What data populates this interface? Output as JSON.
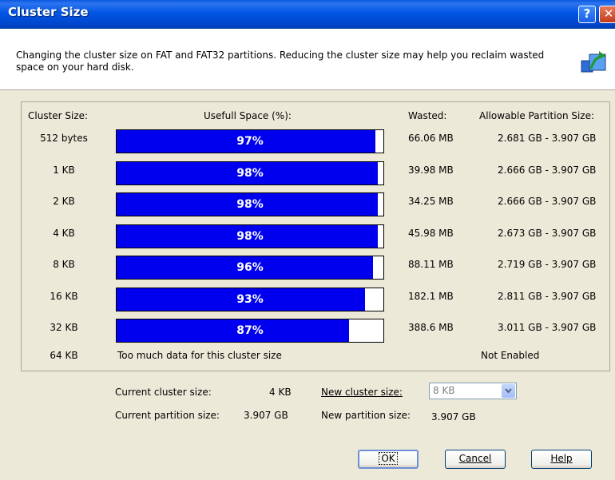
{
  "window": {
    "title": "Cluster Size"
  },
  "header": {
    "description": "Changing the cluster size on FAT and FAT32 partitions. Reducing the cluster size may help you reclaim wasted space on your hard disk."
  },
  "table": {
    "columns": {
      "cluster_size": "Cluster Size:",
      "useful_space": "Usefull Space (%):",
      "wasted": "Wasted:",
      "allowable": "Allowable Partition Size:"
    },
    "rows": [
      {
        "cluster": "512 bytes",
        "percent_label": "97%",
        "percent": 97,
        "wasted": "66.06 MB",
        "allowable": "2.681 GB - 3.907 GB"
      },
      {
        "cluster": "1 KB",
        "percent_label": "98%",
        "percent": 98,
        "wasted": "39.98 MB",
        "allowable": "2.666 GB - 3.907 GB"
      },
      {
        "cluster": "2 KB",
        "percent_label": "98%",
        "percent": 98,
        "wasted": "34.25 MB",
        "allowable": "2.666 GB - 3.907 GB"
      },
      {
        "cluster": "4 KB",
        "percent_label": "98%",
        "percent": 98,
        "wasted": "45.98 MB",
        "allowable": "2.673 GB - 3.907 GB"
      },
      {
        "cluster": "8 KB",
        "percent_label": "96%",
        "percent": 96,
        "wasted": "88.11 MB",
        "allowable": "2.719 GB - 3.907 GB"
      },
      {
        "cluster": "16 KB",
        "percent_label": "93%",
        "percent": 93,
        "wasted": "182.1 MB",
        "allowable": "2.811 GB - 3.907 GB"
      },
      {
        "cluster": "32 KB",
        "percent_label": "87%",
        "percent": 87,
        "wasted": "388.6 MB",
        "allowable": "3.011 GB - 3.907 GB"
      }
    ],
    "last_row": {
      "cluster": "64 KB",
      "message": "Too much data for this cluster size",
      "allowable": "Not Enabled"
    }
  },
  "info": {
    "current_cluster_label": "Current cluster size:",
    "current_cluster_value": "4 KB",
    "current_partition_label": "Current partition size:",
    "current_partition_value": "3.907 GB",
    "new_cluster_label": "New cluster size:",
    "new_cluster_value": "8 KB",
    "new_partition_label": "New partition size:",
    "new_partition_value": "3.907 GB"
  },
  "buttons": {
    "ok": "OK",
    "cancel": "Cancel",
    "help": "Help"
  },
  "colors": {
    "bar_fill": "#0000ee",
    "titlebar": "#0054e3"
  },
  "icons": {
    "help": "question-icon",
    "close": "close-icon",
    "header": "resize-arrow-icon"
  }
}
